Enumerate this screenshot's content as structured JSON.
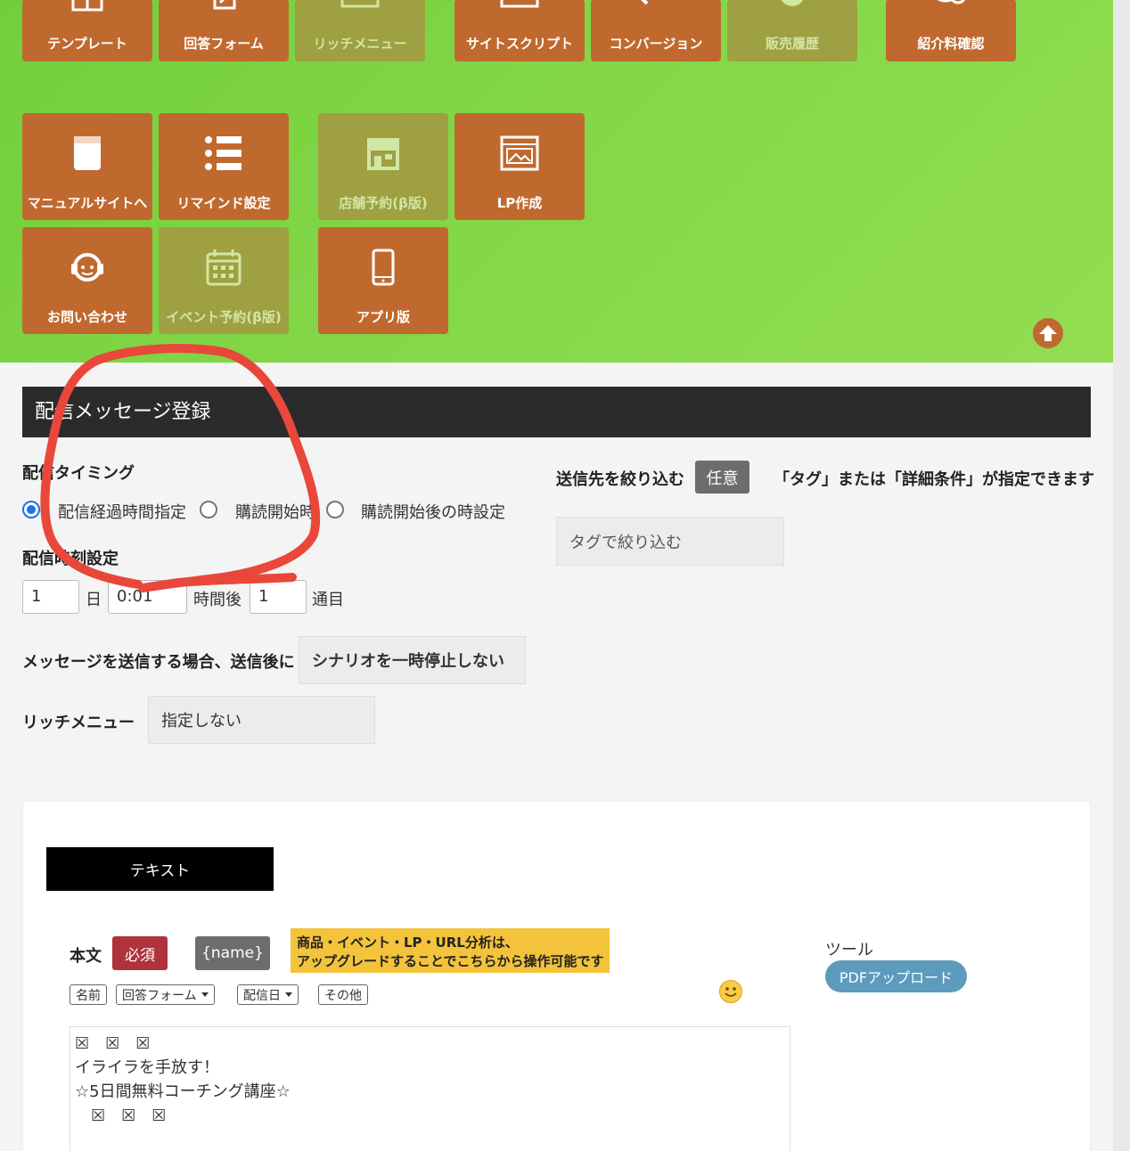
{
  "menu": {
    "row1": [
      {
        "label": "テンプレート",
        "icon": "template-icon",
        "enabled": true
      },
      {
        "label": "回答フォーム",
        "icon": "form-edit-icon",
        "enabled": true
      },
      {
        "label": "リッチメニュー",
        "icon": "rich-menu-icon",
        "enabled": false
      },
      {
        "label": "サイトスクリプト",
        "icon": "site-script-icon",
        "enabled": true
      },
      {
        "label": "コンバージョン",
        "icon": "conversion-icon",
        "enabled": true
      },
      {
        "label": "販売履歴",
        "icon": "sales-history-icon",
        "enabled": false
      },
      {
        "label": "紹介料確認",
        "icon": "referral-fee-icon",
        "enabled": true
      }
    ],
    "row2": [
      {
        "label": "マニュアルサイトへ",
        "icon": "manual-book-icon",
        "enabled": true
      },
      {
        "label": "リマインド設定",
        "icon": "list-icon",
        "enabled": true
      },
      {
        "label": "店舗予約(β版)",
        "icon": "store-icon",
        "enabled": false
      },
      {
        "label": "LP作成",
        "icon": "landing-page-icon",
        "enabled": true
      }
    ],
    "row3": [
      {
        "label": "お問い合わせ",
        "icon": "support-headset-icon",
        "enabled": true
      },
      {
        "label": "イベント予約(β版)",
        "icon": "calendar-icon",
        "enabled": false
      },
      {
        "label": "アプリ版",
        "icon": "smartphone-icon",
        "enabled": true
      }
    ]
  },
  "section": {
    "title": "配信メッセージ登録"
  },
  "timing": {
    "label": "配信タイミング",
    "options": [
      "配信経過時間指定",
      "購読開始時",
      "購読開始後の時設定"
    ],
    "selected_index": 0
  },
  "schedule": {
    "label": "配信時刻設定",
    "day_value": "1",
    "day_unit": "日",
    "time_value": "0:01",
    "time_unit": "時間後",
    "count_value": "1",
    "count_unit": "通目"
  },
  "after_send": {
    "label": "メッセージを送信する場合、送信後に",
    "value": "シナリオを一時停止しない"
  },
  "rich_menu": {
    "label": "リッチメニュー",
    "value": "指定しない"
  },
  "filter": {
    "label": "送信先を絞り込む",
    "badge": "任意",
    "note": "「タグ」または「詳細条件」が指定できます",
    "tag_placeholder": "タグで絞り込む"
  },
  "editor": {
    "tab_label": "テキスト",
    "body_label": "本文",
    "required_badge": "必須",
    "name_button": "{name}",
    "notice_line1": "商品・イベント・LP・URL分析は、",
    "notice_line2": "アップグレードすることでこちらから操作可能です",
    "chips": [
      {
        "label": "名前",
        "dropdown": false
      },
      {
        "label": "回答フォーム",
        "dropdown": true
      },
      {
        "label": "配信日",
        "dropdown": true
      },
      {
        "label": "その他",
        "dropdown": false
      }
    ],
    "tools_label": "ツール",
    "pdf_button": "PDFアップロード",
    "content_lines": [
      "☒　☒　☒",
      "イライラを手放す！",
      "☆5日間無料コーチング講座☆",
      "　☒　☒　☒"
    ]
  },
  "colors": {
    "tile": "#c0692f",
    "tile_disabled": "#9fa042",
    "header_green": "#7fd444",
    "section_bar": "#2b2b2b",
    "required": "#b0323a",
    "notice": "#f3c33b",
    "pdf_button": "#5d9bbd",
    "annotation": "#e8473a"
  }
}
